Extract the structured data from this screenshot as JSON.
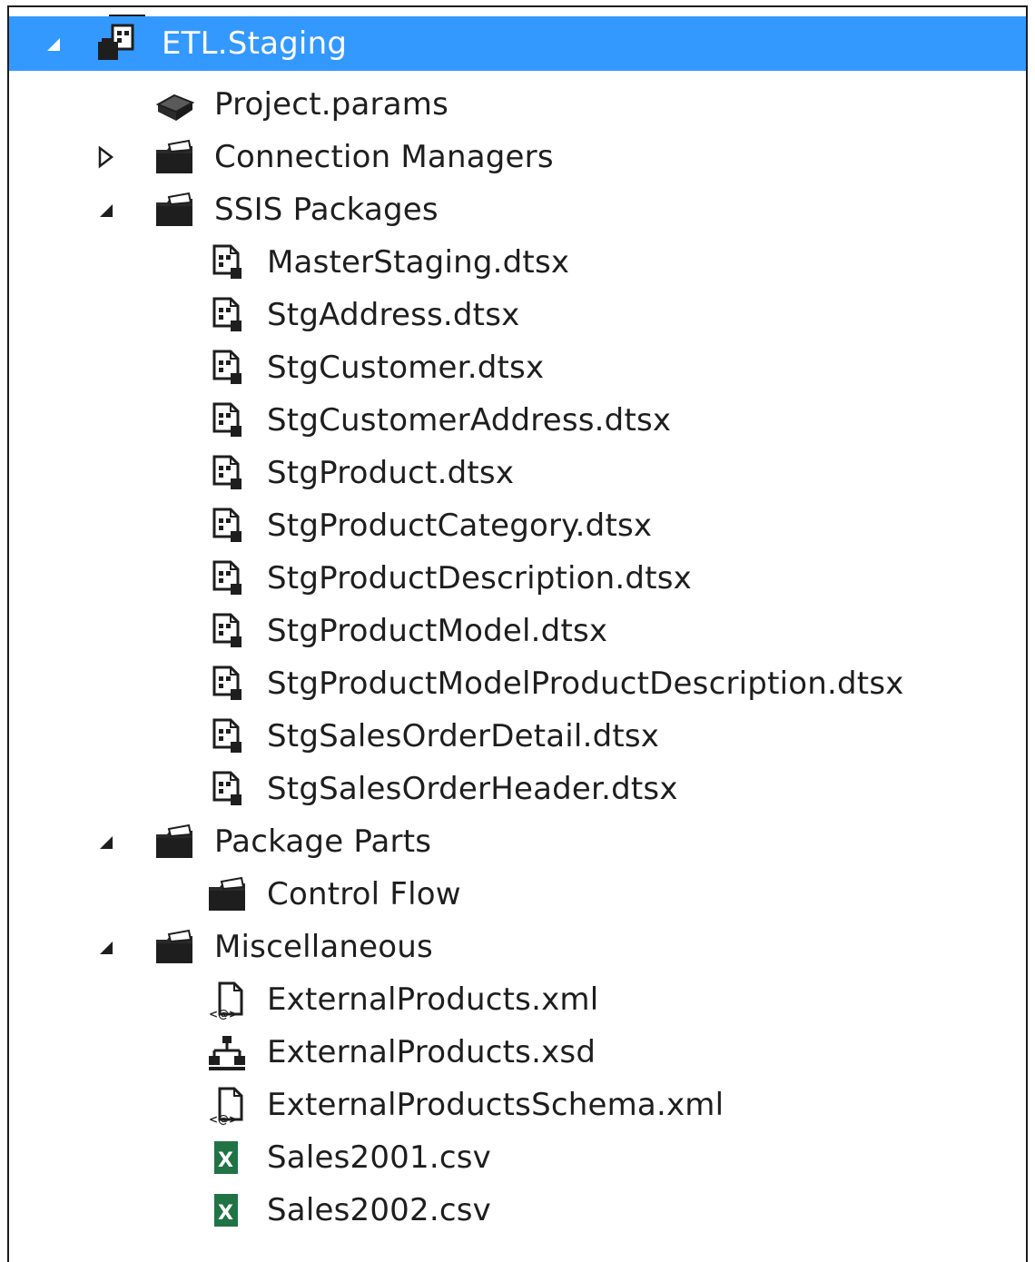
{
  "tree": {
    "root": {
      "label": "ETL.Staging",
      "expanded": true,
      "icon": "ssis-project-icon"
    },
    "items": [
      {
        "label": "Project.params",
        "icon": "params-icon",
        "level": 1,
        "expander": "none"
      },
      {
        "label": "Connection Managers",
        "icon": "folder-icon",
        "level": 1,
        "expander": "collapsed"
      },
      {
        "label": "SSIS Packages",
        "icon": "folder-icon",
        "level": 1,
        "expander": "expanded"
      },
      {
        "label": "MasterStaging.dtsx",
        "icon": "package-icon",
        "level": 2,
        "expander": "none"
      },
      {
        "label": "StgAddress.dtsx",
        "icon": "package-icon",
        "level": 2,
        "expander": "none"
      },
      {
        "label": "StgCustomer.dtsx",
        "icon": "package-icon",
        "level": 2,
        "expander": "none"
      },
      {
        "label": "StgCustomerAddress.dtsx",
        "icon": "package-icon",
        "level": 2,
        "expander": "none"
      },
      {
        "label": "StgProduct.dtsx",
        "icon": "package-icon",
        "level": 2,
        "expander": "none"
      },
      {
        "label": "StgProductCategory.dtsx",
        "icon": "package-icon",
        "level": 2,
        "expander": "none"
      },
      {
        "label": "StgProductDescription.dtsx",
        "icon": "package-icon",
        "level": 2,
        "expander": "none"
      },
      {
        "label": "StgProductModel.dtsx",
        "icon": "package-icon",
        "level": 2,
        "expander": "none"
      },
      {
        "label": "StgProductModelProductDescription.dtsx",
        "icon": "package-icon",
        "level": 2,
        "expander": "none"
      },
      {
        "label": "StgSalesOrderDetail.dtsx",
        "icon": "package-icon",
        "level": 2,
        "expander": "none"
      },
      {
        "label": "StgSalesOrderHeader.dtsx",
        "icon": "package-icon",
        "level": 2,
        "expander": "none"
      },
      {
        "label": "Package Parts",
        "icon": "folder-icon",
        "level": 1,
        "expander": "expanded"
      },
      {
        "label": "Control Flow",
        "icon": "folder-icon",
        "level": 2,
        "expander": "none"
      },
      {
        "label": "Miscellaneous",
        "icon": "folder-icon",
        "level": 1,
        "expander": "expanded"
      },
      {
        "label": "ExternalProducts.xml",
        "icon": "xml-file-icon",
        "level": 2,
        "expander": "none"
      },
      {
        "label": "ExternalProducts.xsd",
        "icon": "xsd-schema-icon",
        "level": 2,
        "expander": "none"
      },
      {
        "label": "ExternalProductsSchema.xml",
        "icon": "xml-file-icon",
        "level": 2,
        "expander": "none"
      },
      {
        "label": "Sales2001.csv",
        "icon": "excel-csv-icon",
        "level": 2,
        "expander": "none"
      },
      {
        "label": "Sales2002.csv",
        "icon": "excel-csv-icon",
        "level": 2,
        "expander": "none"
      }
    ]
  },
  "colors": {
    "selection": "#3399ff",
    "text": "#1e1e1e",
    "excel_green": "#217346"
  }
}
